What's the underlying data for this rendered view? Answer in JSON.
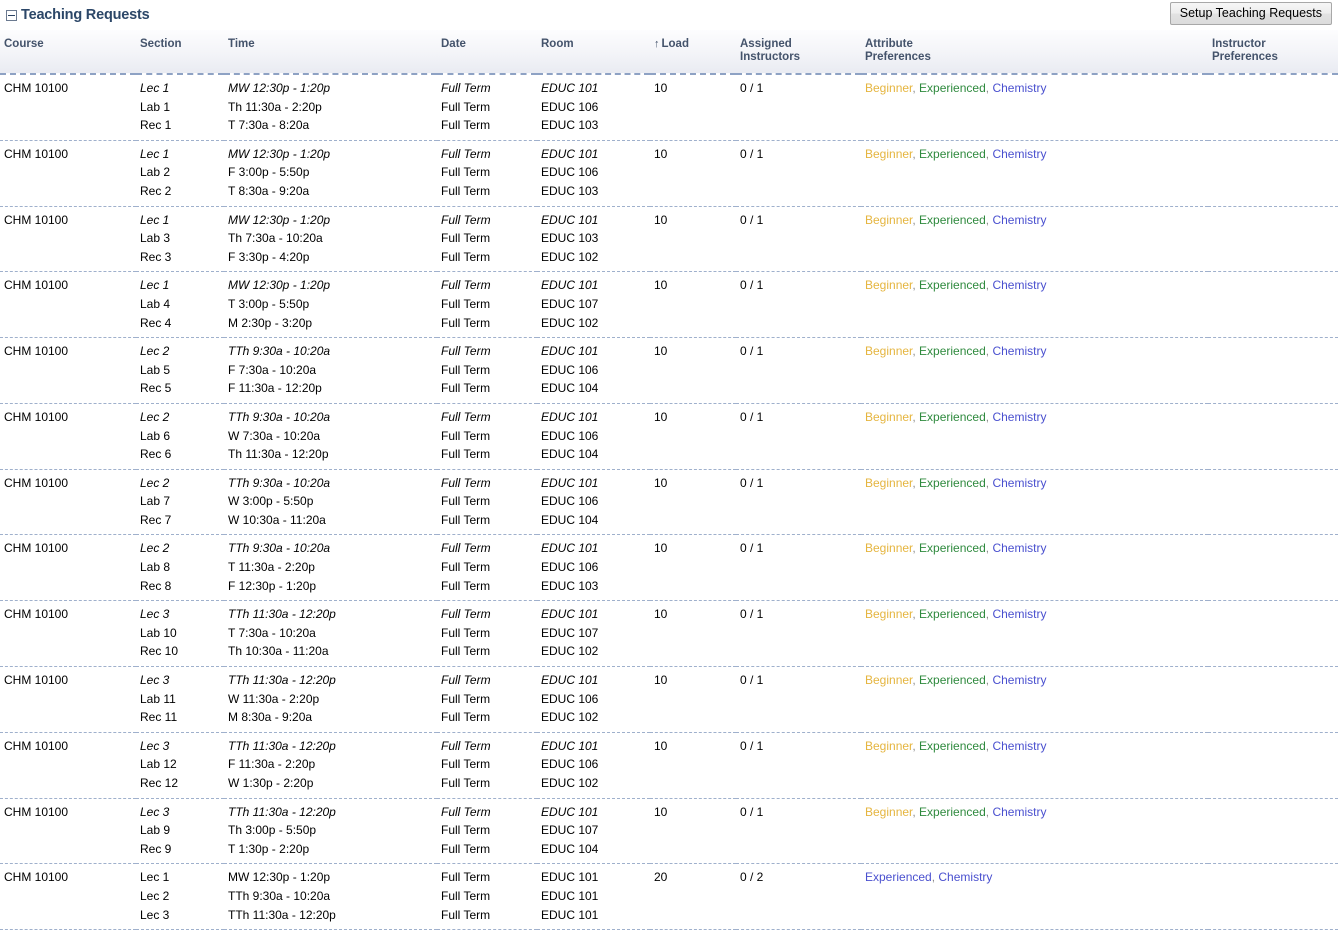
{
  "panel": {
    "title": "Teaching Requests",
    "collapse_icon": "collapse-minus-box-icon",
    "setup_button_label": "Setup Teaching Requests"
  },
  "table": {
    "columns": [
      {
        "key": "course",
        "label": "Course"
      },
      {
        "key": "section",
        "label": "Section"
      },
      {
        "key": "time",
        "label": "Time"
      },
      {
        "key": "date",
        "label": "Date"
      },
      {
        "key": "room",
        "label": "Room"
      },
      {
        "key": "load",
        "label": "Load",
        "sort": "asc",
        "sort_glyph": "↑"
      },
      {
        "key": "assigned",
        "label_line1": "Assigned",
        "label_line2": "Instructors"
      },
      {
        "key": "attribute",
        "label_line1": "Attribute",
        "label_line2": "Preferences"
      },
      {
        "key": "instructor",
        "label_line1": "Instructor",
        "label_line2": "Preferences"
      }
    ],
    "rows": [
      {
        "course": "CHM 10100",
        "sections": [
          "Lec 1",
          "Lab 1",
          "Rec 1"
        ],
        "times": [
          "MW 12:30p - 1:20p",
          "Th 11:30a - 2:20p",
          "T 7:30a - 8:20a"
        ],
        "dates": [
          "Full Term",
          "Full Term",
          "Full Term"
        ],
        "rooms": [
          "EDUC 101",
          "EDUC 106",
          "EDUC 103"
        ],
        "load": "10",
        "assigned": "0 / 1",
        "attributes": [
          {
            "text": "Beginner",
            "color_class": "attr-beginner"
          },
          {
            "text": "Experienced",
            "color_class": "attr-experienced"
          },
          {
            "text": "Chemistry",
            "color_class": "attr-chemistry"
          }
        ],
        "instructor_prefs": "",
        "first_line_italic": true
      },
      {
        "course": "CHM 10100",
        "sections": [
          "Lec 1",
          "Lab 2",
          "Rec 2"
        ],
        "times": [
          "MW 12:30p - 1:20p",
          "F 3:00p - 5:50p",
          "T 8:30a - 9:20a"
        ],
        "dates": [
          "Full Term",
          "Full Term",
          "Full Term"
        ],
        "rooms": [
          "EDUC 101",
          "EDUC 106",
          "EDUC 103"
        ],
        "load": "10",
        "assigned": "0 / 1",
        "attributes": [
          {
            "text": "Beginner",
            "color_class": "attr-beginner"
          },
          {
            "text": "Experienced",
            "color_class": "attr-experienced"
          },
          {
            "text": "Chemistry",
            "color_class": "attr-chemistry"
          }
        ],
        "instructor_prefs": "",
        "first_line_italic": true
      },
      {
        "course": "CHM 10100",
        "sections": [
          "Lec 1",
          "Lab 3",
          "Rec 3"
        ],
        "times": [
          "MW 12:30p - 1:20p",
          "Th 7:30a - 10:20a",
          "F 3:30p - 4:20p"
        ],
        "dates": [
          "Full Term",
          "Full Term",
          "Full Term"
        ],
        "rooms": [
          "EDUC 101",
          "EDUC 103",
          "EDUC 102"
        ],
        "load": "10",
        "assigned": "0 / 1",
        "attributes": [
          {
            "text": "Beginner",
            "color_class": "attr-beginner"
          },
          {
            "text": "Experienced",
            "color_class": "attr-experienced"
          },
          {
            "text": "Chemistry",
            "color_class": "attr-chemistry"
          }
        ],
        "instructor_prefs": "",
        "first_line_italic": true
      },
      {
        "course": "CHM 10100",
        "sections": [
          "Lec 1",
          "Lab 4",
          "Rec 4"
        ],
        "times": [
          "MW 12:30p - 1:20p",
          "T 3:00p - 5:50p",
          "M 2:30p - 3:20p"
        ],
        "dates": [
          "Full Term",
          "Full Term",
          "Full Term"
        ],
        "rooms": [
          "EDUC 101",
          "EDUC 107",
          "EDUC 102"
        ],
        "load": "10",
        "assigned": "0 / 1",
        "attributes": [
          {
            "text": "Beginner",
            "color_class": "attr-beginner"
          },
          {
            "text": "Experienced",
            "color_class": "attr-experienced"
          },
          {
            "text": "Chemistry",
            "color_class": "attr-chemistry"
          }
        ],
        "instructor_prefs": "",
        "first_line_italic": true
      },
      {
        "course": "CHM 10100",
        "sections": [
          "Lec 2",
          "Lab 5",
          "Rec 5"
        ],
        "times": [
          "TTh 9:30a - 10:20a",
          "F 7:30a - 10:20a",
          "F 11:30a - 12:20p"
        ],
        "dates": [
          "Full Term",
          "Full Term",
          "Full Term"
        ],
        "rooms": [
          "EDUC 101",
          "EDUC 106",
          "EDUC 104"
        ],
        "load": "10",
        "assigned": "0 / 1",
        "attributes": [
          {
            "text": "Beginner",
            "color_class": "attr-beginner"
          },
          {
            "text": "Experienced",
            "color_class": "attr-experienced"
          },
          {
            "text": "Chemistry",
            "color_class": "attr-chemistry"
          }
        ],
        "instructor_prefs": "",
        "first_line_italic": true
      },
      {
        "course": "CHM 10100",
        "sections": [
          "Lec 2",
          "Lab 6",
          "Rec 6"
        ],
        "times": [
          "TTh 9:30a - 10:20a",
          "W 7:30a - 10:20a",
          "Th 11:30a - 12:20p"
        ],
        "dates": [
          "Full Term",
          "Full Term",
          "Full Term"
        ],
        "rooms": [
          "EDUC 101",
          "EDUC 106",
          "EDUC 104"
        ],
        "load": "10",
        "assigned": "0 / 1",
        "attributes": [
          {
            "text": "Beginner",
            "color_class": "attr-beginner"
          },
          {
            "text": "Experienced",
            "color_class": "attr-experienced"
          },
          {
            "text": "Chemistry",
            "color_class": "attr-chemistry"
          }
        ],
        "instructor_prefs": "",
        "first_line_italic": true
      },
      {
        "course": "CHM 10100",
        "sections": [
          "Lec 2",
          "Lab 7",
          "Rec 7"
        ],
        "times": [
          "TTh 9:30a - 10:20a",
          "W 3:00p - 5:50p",
          "W 10:30a - 11:20a"
        ],
        "dates": [
          "Full Term",
          "Full Term",
          "Full Term"
        ],
        "rooms": [
          "EDUC 101",
          "EDUC 106",
          "EDUC 104"
        ],
        "load": "10",
        "assigned": "0 / 1",
        "attributes": [
          {
            "text": "Beginner",
            "color_class": "attr-beginner"
          },
          {
            "text": "Experienced",
            "color_class": "attr-experienced"
          },
          {
            "text": "Chemistry",
            "color_class": "attr-chemistry"
          }
        ],
        "instructor_prefs": "",
        "first_line_italic": true
      },
      {
        "course": "CHM 10100",
        "sections": [
          "Lec 2",
          "Lab 8",
          "Rec 8"
        ],
        "times": [
          "TTh 9:30a - 10:20a",
          "T 11:30a - 2:20p",
          "F 12:30p - 1:20p"
        ],
        "dates": [
          "Full Term",
          "Full Term",
          "Full Term"
        ],
        "rooms": [
          "EDUC 101",
          "EDUC 106",
          "EDUC 103"
        ],
        "load": "10",
        "assigned": "0 / 1",
        "attributes": [
          {
            "text": "Beginner",
            "color_class": "attr-beginner"
          },
          {
            "text": "Experienced",
            "color_class": "attr-experienced"
          },
          {
            "text": "Chemistry",
            "color_class": "attr-chemistry"
          }
        ],
        "instructor_prefs": "",
        "first_line_italic": true
      },
      {
        "course": "CHM 10100",
        "sections": [
          "Lec 3",
          "Lab 10",
          "Rec 10"
        ],
        "times": [
          "TTh 11:30a - 12:20p",
          "T 7:30a - 10:20a",
          "Th 10:30a - 11:20a"
        ],
        "dates": [
          "Full Term",
          "Full Term",
          "Full Term"
        ],
        "rooms": [
          "EDUC 101",
          "EDUC 107",
          "EDUC 102"
        ],
        "load": "10",
        "assigned": "0 / 1",
        "attributes": [
          {
            "text": "Beginner",
            "color_class": "attr-beginner"
          },
          {
            "text": "Experienced",
            "color_class": "attr-experienced"
          },
          {
            "text": "Chemistry",
            "color_class": "attr-chemistry"
          }
        ],
        "instructor_prefs": "",
        "first_line_italic": true
      },
      {
        "course": "CHM 10100",
        "sections": [
          "Lec 3",
          "Lab 11",
          "Rec 11"
        ],
        "times": [
          "TTh 11:30a - 12:20p",
          "W 11:30a - 2:20p",
          "M 8:30a - 9:20a"
        ],
        "dates": [
          "Full Term",
          "Full Term",
          "Full Term"
        ],
        "rooms": [
          "EDUC 101",
          "EDUC 106",
          "EDUC 102"
        ],
        "load": "10",
        "assigned": "0 / 1",
        "attributes": [
          {
            "text": "Beginner",
            "color_class": "attr-beginner"
          },
          {
            "text": "Experienced",
            "color_class": "attr-experienced"
          },
          {
            "text": "Chemistry",
            "color_class": "attr-chemistry"
          }
        ],
        "instructor_prefs": "",
        "first_line_italic": true
      },
      {
        "course": "CHM 10100",
        "sections": [
          "Lec 3",
          "Lab 12",
          "Rec 12"
        ],
        "times": [
          "TTh 11:30a - 12:20p",
          "F 11:30a - 2:20p",
          "W 1:30p - 2:20p"
        ],
        "dates": [
          "Full Term",
          "Full Term",
          "Full Term"
        ],
        "rooms": [
          "EDUC 101",
          "EDUC 106",
          "EDUC 102"
        ],
        "load": "10",
        "assigned": "0 / 1",
        "attributes": [
          {
            "text": "Beginner",
            "color_class": "attr-beginner"
          },
          {
            "text": "Experienced",
            "color_class": "attr-experienced"
          },
          {
            "text": "Chemistry",
            "color_class": "attr-chemistry"
          }
        ],
        "instructor_prefs": "",
        "first_line_italic": true
      },
      {
        "course": "CHM 10100",
        "sections": [
          "Lec 3",
          "Lab 9",
          "Rec 9"
        ],
        "times": [
          "TTh 11:30a - 12:20p",
          "Th 3:00p - 5:50p",
          "T 1:30p - 2:20p"
        ],
        "dates": [
          "Full Term",
          "Full Term",
          "Full Term"
        ],
        "rooms": [
          "EDUC 101",
          "EDUC 107",
          "EDUC 104"
        ],
        "load": "10",
        "assigned": "0 / 1",
        "attributes": [
          {
            "text": "Beginner",
            "color_class": "attr-beginner"
          },
          {
            "text": "Experienced",
            "color_class": "attr-experienced"
          },
          {
            "text": "Chemistry",
            "color_class": "attr-chemistry"
          }
        ],
        "instructor_prefs": "",
        "first_line_italic": true
      },
      {
        "course": "CHM 10100",
        "sections": [
          "Lec 1",
          "Lec 2",
          "Lec 3"
        ],
        "times": [
          "MW 12:30p - 1:20p",
          "TTh 9:30a - 10:20a",
          "TTh 11:30a - 12:20p"
        ],
        "dates": [
          "Full Term",
          "Full Term",
          "Full Term"
        ],
        "rooms": [
          "EDUC 101",
          "EDUC 101",
          "EDUC 101"
        ],
        "load": "20",
        "assigned": "0 / 2",
        "attributes": [
          {
            "text": "Experienced",
            "color_class": "attr-blue"
          },
          {
            "text": "Chemistry",
            "color_class": "attr-blue"
          }
        ],
        "instructor_prefs": "",
        "first_line_italic": false
      }
    ]
  }
}
